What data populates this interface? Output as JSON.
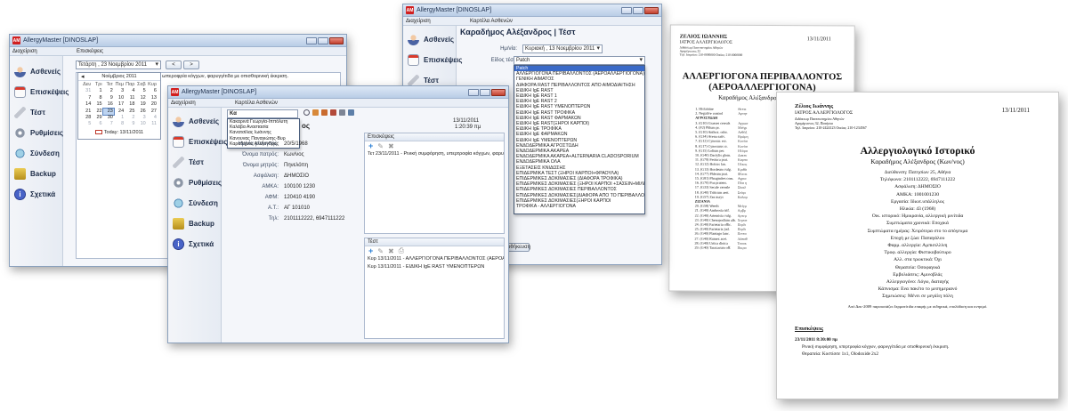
{
  "app": {
    "title": "AllergyMaster [DINOSLAP]",
    "icon_text": "AM"
  },
  "menu": {
    "admin": "Διαχείριση",
    "visits": "Επισκέψεις",
    "patient_card": "Καρτέλα Ασθενών"
  },
  "nav": {
    "patients": "Ασθενείς",
    "visits": "Επισκέψεις",
    "test": "Τέστ",
    "settings": "Ρυθμίσεις",
    "connect": "Σύνδεση",
    "backup": "Backup",
    "about": "Σχετικά"
  },
  "window1": {
    "date_value": "Τετάρτη , 23  Νοεμβρίου  2011",
    "nav_prev": "<",
    "nav_next": ">",
    "visit_text": "ωπεροφρία κόγχων, φαρυγγίτιδα με οπισθορινική έκκριση.",
    "calendar": {
      "month": "Νοέμβριος 2011",
      "weekdays": [
        "Δευ",
        "Τρι",
        "Τετ",
        "Πεμ",
        "Παρ",
        "Σαβ",
        "Κυρ"
      ],
      "days": [
        "31",
        "1",
        "2",
        "3",
        "4",
        "5",
        "6",
        "7",
        "8",
        "9",
        "10",
        "11",
        "12",
        "13",
        "14",
        "15",
        "16",
        "17",
        "18",
        "19",
        "20",
        "21",
        "22",
        "23",
        "24",
        "25",
        "26",
        "27",
        "28",
        "29",
        "30",
        "1",
        "2",
        "3",
        "4",
        "5",
        "6",
        "7",
        "8",
        "9",
        "10",
        "11"
      ],
      "today": "Today: 13/11/2011"
    }
  },
  "window2": {
    "search_value": "Κα",
    "suggestions": [
      "Κακαρινά Γεωργία-Ιππόλυτη",
      "Καλάβα Αναστασία",
      "Κανατσίλας Ιωάννης",
      "Κανουνας Παναγιώτης-Βυρ",
      "Καραδήμος Αλέξανδρος"
    ],
    "date": "13/11/2011",
    "time": "1:20:39 πμ",
    "title_fragment": "ος",
    "fields": [
      {
        "label": "Ημ/νία γέννησης:",
        "value": "20/5/1968"
      },
      {
        "label": "Όνομα πατρός:",
        "value": "Κων/νος"
      },
      {
        "label": "Όνομα μητρός:",
        "value": "Πηνελόπη"
      },
      {
        "label": "Ασφάλιση:",
        "value": "ΔΗΜΟΣΙΟ"
      },
      {
        "label": "ΑΜΚΑ:",
        "value": "100100 1230"
      },
      {
        "label": "ΑΦΜ:",
        "value": "120410 4190"
      },
      {
        "label": "Α.Τ.:",
        "value": "ΑΓ 101010"
      },
      {
        "label": "Τηλ:",
        "value": "2101112222, 6947111222"
      }
    ],
    "visits_header": "Επισκέψεις",
    "visits_item": "Τετ 23/11/2011 - Ρινική συμφόρηση, υπερτροφία κόγχων, φαρυγ",
    "tests_header": "Τέστ",
    "tests_items": [
      "Κυρ 13/11/2011 - ΑΛΛΕΡΓΙΟΓΟΝΑ ΠΕΡΙΒΑΛΛΟΝΤΟΣ (ΑΕΡΟΑΛΛΕ",
      "Κυρ 13/11/2011 - ΕΙΔΙΚΗ IgE RAST ΥΜΕΝΟΠΤΕΡΩΝ"
    ]
  },
  "window3": {
    "heading": "Καραδήμος Αλέξανδρος | Τέστ",
    "date_label": "Ημ/νία:",
    "date_value": "Κυριακή , 13  Νοεμβρίου  2011",
    "type_label": "Είδος τέστ:",
    "type_value": "Patch",
    "save_button": "Αποθήκευση",
    "options": [
      "Patch",
      "ΑΛΛΕΡΓΙΟΓΟΝΑ ΠΕΡΙΒΑΛΛΟΝΤΟΣ (ΑΕΡΟΑΛΛΕΡΓΙΟΓΟΝΑ)",
      "ΓΕΝΙΚΗ ΑΙΜΑΤΟΣ",
      "ΔΙΑΦΟΡΑ RAST ΠΕΡΙΒΑΛΛΟΝΤΟΣ ΑΠΟ ΑΙΜΟΔΙΑΙΤΗΣΗ",
      "ΕΙΔΙΚΗ IgE RAST",
      "ΕΙΔΙΚΗ IgE RAST 1",
      "ΕΙΔΙΚΗ IgE RAST 2",
      "ΕΙΔΙΚΗ IgE RAST ΥΜΕΝΟΠΤΕΡΩΝ",
      "ΕΙΔΙΚΗ IgE RAST ΤΡΟΦΙΚΑ",
      "ΕΙΔΙΚΗ IgE RAST ΦΑΡΜΑΚΩΝ",
      "ΕΙΔΙΚΗ IgE RAST(ΞΗΡΟΙ ΚΑΡΠΟΙ)",
      "ΕΙΔΙΚΗ IgE ΤΡΟΦΙΚΑ",
      "ΕΙΔΙΚΗ IgE ΦΑΡΜΑΚΩΝ",
      "ΕΙΔΙΚΗ IgE ΥΜΕΝΟΠΤΕΡΩΝ",
      "ΕΝΔΟΔΕΡΜΙΚΑ ΑΓΡΟΣΤΩΔΗ",
      "ΕΝΔΟΔΕΡΜΙΚΑ ΑΚΑΡΕΑ",
      "ΕΝΔΟΔΕΡΜΙΚΑ ΑΚΑΡΕΑ+ALTERNARIA CLADOSPORIUM",
      "ΕΝΔΟΔΕΡΜΙΚΑ ΟΛΑ",
      "ΕΞΕΤΑΣΕΙΣ ΚΝΙΔΩΣΗΣ",
      "ΕΠΙΔΕΡΜΙΚΑ ΤΕΣΤ (ΞΗΡΟΙ ΚΑΡΠΟΙ+ΦΡΑΟΥΛΑ)",
      "ΕΠΙΔΕΡΜΙΚΕΣ ΔΟΚΙΜΑΣΙΕΣ (ΔΙΑΦΟΡΑ ΤΡΟΦΙΚΑ)",
      "ΕΠΙΔΕΡΜΙΚΕΣ ΔΟΚΙΜΑΣΙΕΣ (ΞΗΡΟΙ ΚΑΡΠΟΙ +ΣΑΣΕΙΝ+ΜΙΛΚ)",
      "ΕΠΙΔΕΡΜΙΚΕΣ ΔΟΚΙΜΑΣΙΕΣ ΠΕΡΙΒΑΛΛΟΝΤΟΣ",
      "ΕΠΙΔΕΡΜΙΚΕΣ ΔΟΚΙΜΑΣΙΕΣ(ΔΙΑΦΟΡΑ ΑΠΟ ΤΟ ΠΕΡΙΒΑΛΛΟΝ",
      "ΕΠΙΔΕΡΜΙΚΕΣ ΔΟΚΙΜΑΣΙΕΣ(ΞΗΡΟΙ ΚΑΡΠΟΙ",
      "ΤΡΟΦΙΚΑ - ΑΛΛΕΡΓΙΟΓΟΝΑ"
    ]
  },
  "sheet1": {
    "doctor": "ΖΕΛΙΟΣ ΙΩΑΝΝΗΣ",
    "specialty": "ΙΑΤΡΟΣ ΑΛΛΕΡΓΙΟΛΟΓΟΣ",
    "address1": "Διδάκτωρ Πανεπιστημίου Αθηνών",
    "address2": "Αγαμέμνονος 32",
    "phone": "Τηλ. Ιατρείου: 210-0000000 Οικίας: 210-0000000",
    "date": "13/11/2011",
    "title1": "ΑΛΛΕΡΓΙΟΓΟΝΑ ΠΕΡΙΒΑΛΛΟΝΤΟΣ",
    "title2": "(ΑΕΡΟΑΛΛΕΡΓΙΟΓΟΝΑ)",
    "patient": "Καραδήμος Αλέξανδρος (Κων/νος)",
    "rows": [
      [
        "1. Histamine",
        "Θετικ"
      ],
      [
        "2. Negative control",
        "Αρνητ"
      ],
      [
        "ΑΓΡΟΣΤΩΔΗ",
        ""
      ],
      [
        "3. (G10) Grasses cereals",
        "Αγρωσ"
      ],
      [
        "4. (F2) Phlum pr.",
        "Μείγμ"
      ],
      [
        "5. (G10) Anthox. odor.",
        "Ανθόξ"
      ],
      [
        "6. (G34) Avena sativ.",
        "Βρώμη"
      ],
      [
        "7. (G12) Cynosur. ecr.",
        "Κυνόσ"
      ],
      [
        "8. (G17) Cynosurus cr.",
        "Κυνόσ"
      ],
      [
        "9. (G15) Lolium per.",
        "Ηλύρα"
      ],
      [
        "10. (G40) Dactylis glom.",
        "Δακτυ"
      ],
      [
        "11. (G79) Festuca prat.",
        "Καρπο"
      ],
      [
        "12. (G12) Holcus lan.",
        "Όλκος"
      ],
      [
        "13. (G13) Hordeum vulg.",
        "Κριθά"
      ],
      [
        "14. (G77) Phleum prat.",
        "Φλεοκ"
      ],
      [
        "15. (G81) Phragmites com.",
        "Αγρια"
      ],
      [
        "16. (G70) Poa pratens.",
        "Πόα η"
      ],
      [
        "17. (G33) Secale cereale",
        "Σίκαλ"
      ],
      [
        "18. (G40) Triticum aest.",
        "Στάρι"
      ],
      [
        "19. (G57) Zea mays",
        "Καλαμ"
      ],
      [
        "ΖΙΖΑΝΙΑ",
        ""
      ],
      [
        "20. (G58) Weeds",
        "Μείγμ"
      ],
      [
        "21. (G40) Ambrosia trif.",
        "Αμβρ"
      ],
      [
        "22. (G40) Artemisia vulg.",
        "Αρτεμ"
      ],
      [
        "23. (G40) Chenopodium alb.",
        "Χηνοπ"
      ],
      [
        "24. (G40) Parietaria offic.",
        "Περδι"
      ],
      [
        "25. (G40) Parietaria jud.",
        "Περδι"
      ],
      [
        "26. (G40) Plantago lanc.",
        "Πεντα"
      ],
      [
        "27. (G40) Rumex acet.",
        "Λάπαθ"
      ],
      [
        "28. (G40) Urtica dioica",
        "Τσουκ"
      ],
      [
        "29. (G40) Taraxacum off.",
        "Πικρα"
      ]
    ]
  },
  "sheet2": {
    "doctor": "Ζέλιος Ιωάννης",
    "specialty": "ΙΑΤΡΟΣ ΑΛΛΕΡΓΙΟΛΟΓΟΣ",
    "address1": "Διδάκτωρ Πανεπιστημίου Αθηνών",
    "address2": "Αγαμέμνονος 32, Πατήσια",
    "phone": "Τηλ. Ιατρείου: 210-2424123 Οικίας: 210-1234567",
    "date": "13/11/2011",
    "title": "Αλλεργιολογικό Ιστορικό",
    "patient": "Καραδήμος Αλέξανδρος (Κων/νος)",
    "lines": [
      "Διεύθυνση: Πατησίων 25, Αθήνα",
      "Τηλέφωνο: 2101112222, 6947111222",
      "Ασφάλιση: ΔΗΜΟΣΙΟ",
      "ΑΜΚΑ: 1001001230",
      "Εργασία: Ιδιωτ.υπάλληλος",
      "Ηλικία: 43 (1968)",
      "Οικ. ιστορικό: Ημικρανία, αλλεργική ρινίτιδα",
      "Συμπτώματα χρονικά: Εποχικά",
      "Συμπτώματα ημέρας: Χειρότερα στο το απόγευμα",
      "Εποχή με ζώα: Παπαγάλου",
      "Φαρμ. αλλεργία: Αμπισιλλίνη",
      "Τροφ. αλλεργία: Φιστικοβούτυρο",
      "Αλλ. στα τρωκτικά: Όχι",
      "Θεραπεία: Οσοφαγικά",
      "Εμβολιάσεις: Αμινοβλάς",
      "Αλλεργιογόνο: Λόγω, διαταγής",
      "Κάπνισμα: Ενα πακέτο το μεσημεριανό",
      "Σημειώσεις: Μένει σε μεγάλη πόλη"
    ],
    "note": "Από Δεκ-2009 παρουσιάζει δερματίτιδα επαφής με σιδηρικά, επολάδιση και κνησμό.",
    "visits_header": "Επισκέψεις",
    "visit_date": "23/11/2011 8:30:00 πμ",
    "visit_desc": "Ρινική συμφόρηση, υπερτροφία κόγχων, φαρυγγίτιδα με οπισθορινική έκκριση.",
    "therapy": "Θεραπεία: Κοστίσσε 1x1, Olodoxide 2x2"
  },
  "colors": {
    "titlebar": "#c8d8ec",
    "accent": "#3a6ac8",
    "close": "#c3402e"
  }
}
